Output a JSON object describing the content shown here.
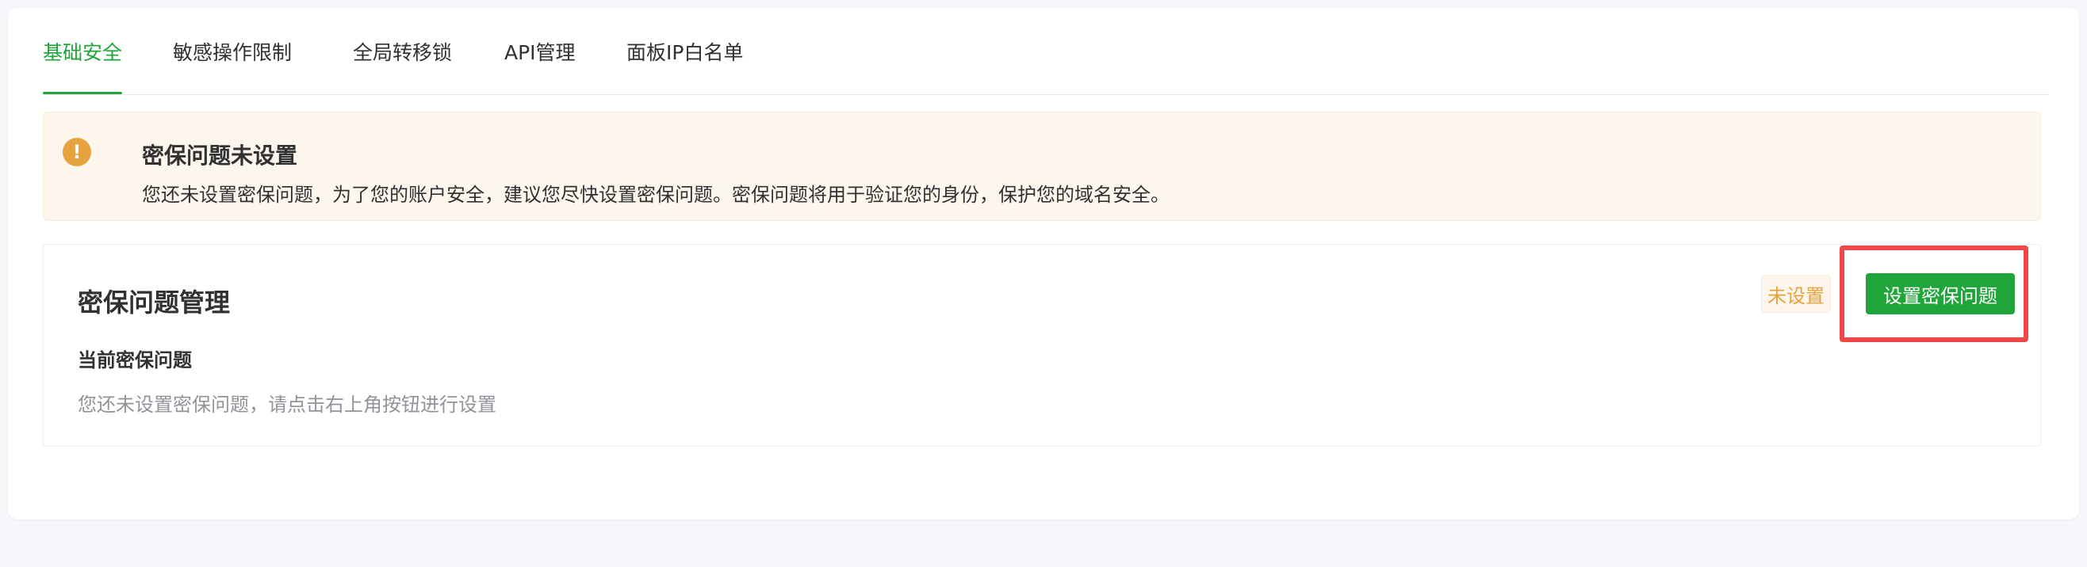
{
  "tabs": [
    {
      "label": "基础安全",
      "active": true
    },
    {
      "label": "敏感操作限制",
      "active": false
    },
    {
      "label": "全局转移锁",
      "active": false
    },
    {
      "label": "API管理",
      "active": false
    },
    {
      "label": "面板IP白名单",
      "active": false
    }
  ],
  "alert": {
    "icon": "warning-icon",
    "icon_glyph": "!",
    "title": "密保问题未设置",
    "description": "您还未设置密保问题，为了您的账户安全，建议您尽快设置密保问题。密保问题将用于验证您的身份，保护您的域名安全。"
  },
  "panel": {
    "title": "密保问题管理",
    "status_badge": "未设置",
    "set_button": "设置密保问题",
    "current_label": "当前密保问题",
    "current_value": "您还未设置密保问题，请点击右上角按钮进行设置"
  },
  "colors": {
    "accent": "#20a53a",
    "warning": "#e6a23c",
    "highlight": "#f04848"
  }
}
